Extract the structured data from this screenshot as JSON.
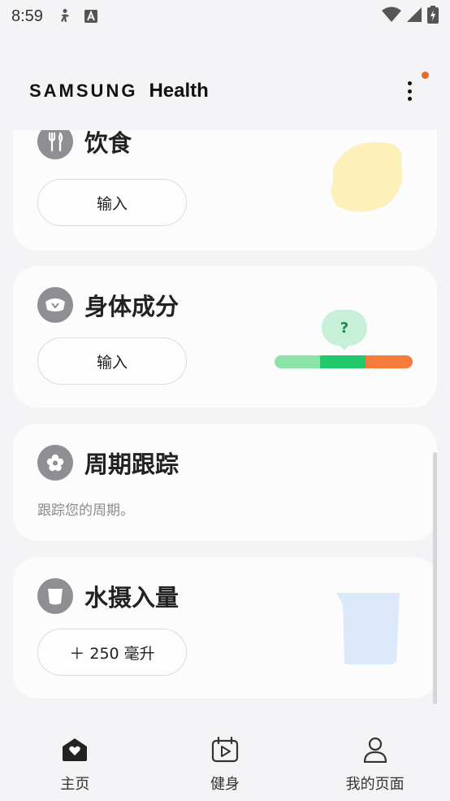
{
  "status_bar": {
    "time": "8:59",
    "icons": [
      "accessibility-icon",
      "a-text-icon",
      "wifi-icon",
      "signal-icon",
      "battery-charging-icon"
    ]
  },
  "header": {
    "brand_samsung": "SAMSUNG",
    "brand_health": "Health",
    "menu_icon": "more-vertical-icon",
    "notification_color": "#e8682a"
  },
  "cards": {
    "food": {
      "title": "饮食",
      "icon": "fork-knife-icon",
      "button_label": "输入"
    },
    "body_composition": {
      "title": "身体成分",
      "icon": "scale-icon",
      "button_label": "输入",
      "indicator_label": "?"
    },
    "cycle": {
      "title": "周期跟踪",
      "icon": "flower-icon",
      "description": "跟踪您的周期。"
    },
    "water": {
      "title": "水摄入量",
      "icon": "cup-icon",
      "button_label": "＋ 250 毫升"
    }
  },
  "bottom_nav": {
    "items": [
      {
        "label": "主页",
        "icon": "home-heart-icon",
        "active": true
      },
      {
        "label": "健身",
        "icon": "calendar-play-icon",
        "active": false
      },
      {
        "label": "我的页面",
        "icon": "person-icon",
        "active": false
      }
    ]
  },
  "colors": {
    "accent_orange": "#f47b3a",
    "green_light": "#8be3a7",
    "green": "#22c86a",
    "lemon": "#fdf0b8",
    "water_glass": "#dbe9fb"
  }
}
